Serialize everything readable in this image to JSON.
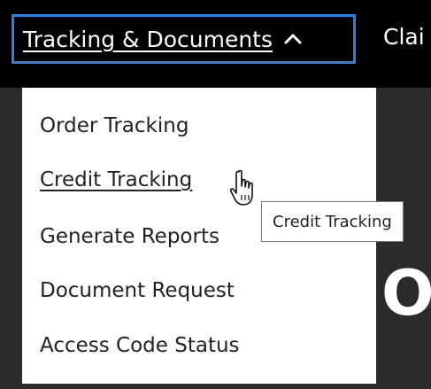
{
  "nav": {
    "active_item": "Tracking & Documents",
    "next_item_partial": "Clai",
    "active_chevron_icon": "chevron-up-icon",
    "focus_color": "#2f7fe0"
  },
  "dropdown": {
    "items": [
      {
        "label": "Order Tracking"
      },
      {
        "label": "Credit Tracking"
      },
      {
        "label": "Generate Reports"
      },
      {
        "label": "Document Request"
      },
      {
        "label": "Access Code Status"
      }
    ],
    "hovered_index": 1
  },
  "tooltip": {
    "text": "Credit Tracking"
  },
  "hero": {
    "partial_heading_letter": "O"
  },
  "cursor": {
    "icon": "hand-pointer-icon"
  }
}
